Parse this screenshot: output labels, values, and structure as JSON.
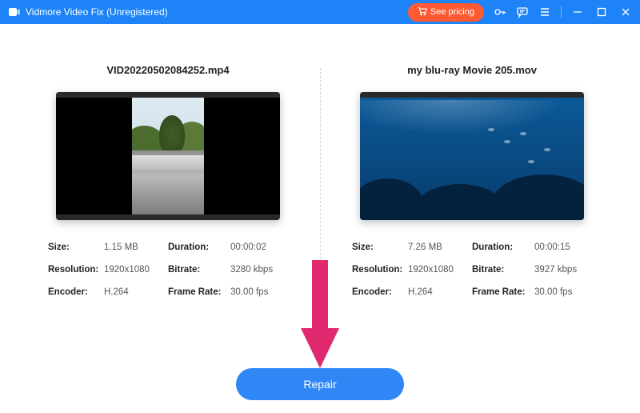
{
  "titlebar": {
    "app_title": "Vidmore Video Fix (Unregistered)",
    "see_pricing_label": "See pricing"
  },
  "left": {
    "filename": "VID20220502084252.mp4",
    "labels": {
      "size": "Size:",
      "duration": "Duration:",
      "resolution": "Resolution:",
      "bitrate": "Bitrate:",
      "encoder": "Encoder:",
      "frame_rate": "Frame Rate:"
    },
    "values": {
      "size": "1.15 MB",
      "duration": "00:00:02",
      "resolution": "1920x1080",
      "bitrate": "3280 kbps",
      "encoder": "H.264",
      "frame_rate": "30.00 fps"
    }
  },
  "right": {
    "filename": "my blu-ray Movie 205.mov",
    "labels": {
      "size": "Size:",
      "duration": "Duration:",
      "resolution": "Resolution:",
      "bitrate": "Bitrate:",
      "encoder": "Encoder:",
      "frame_rate": "Frame Rate:"
    },
    "values": {
      "size": "7.26 MB",
      "duration": "00:00:15",
      "resolution": "1920x1080",
      "bitrate": "3927 kbps",
      "encoder": "H.264",
      "frame_rate": "30.00 fps"
    }
  },
  "actions": {
    "repair_label": "Repair"
  },
  "colors": {
    "accent": "#1e83f7",
    "primary_btn": "#2f87f6",
    "pricing_btn": "#ff5a33",
    "arrow": "#e0296f"
  }
}
